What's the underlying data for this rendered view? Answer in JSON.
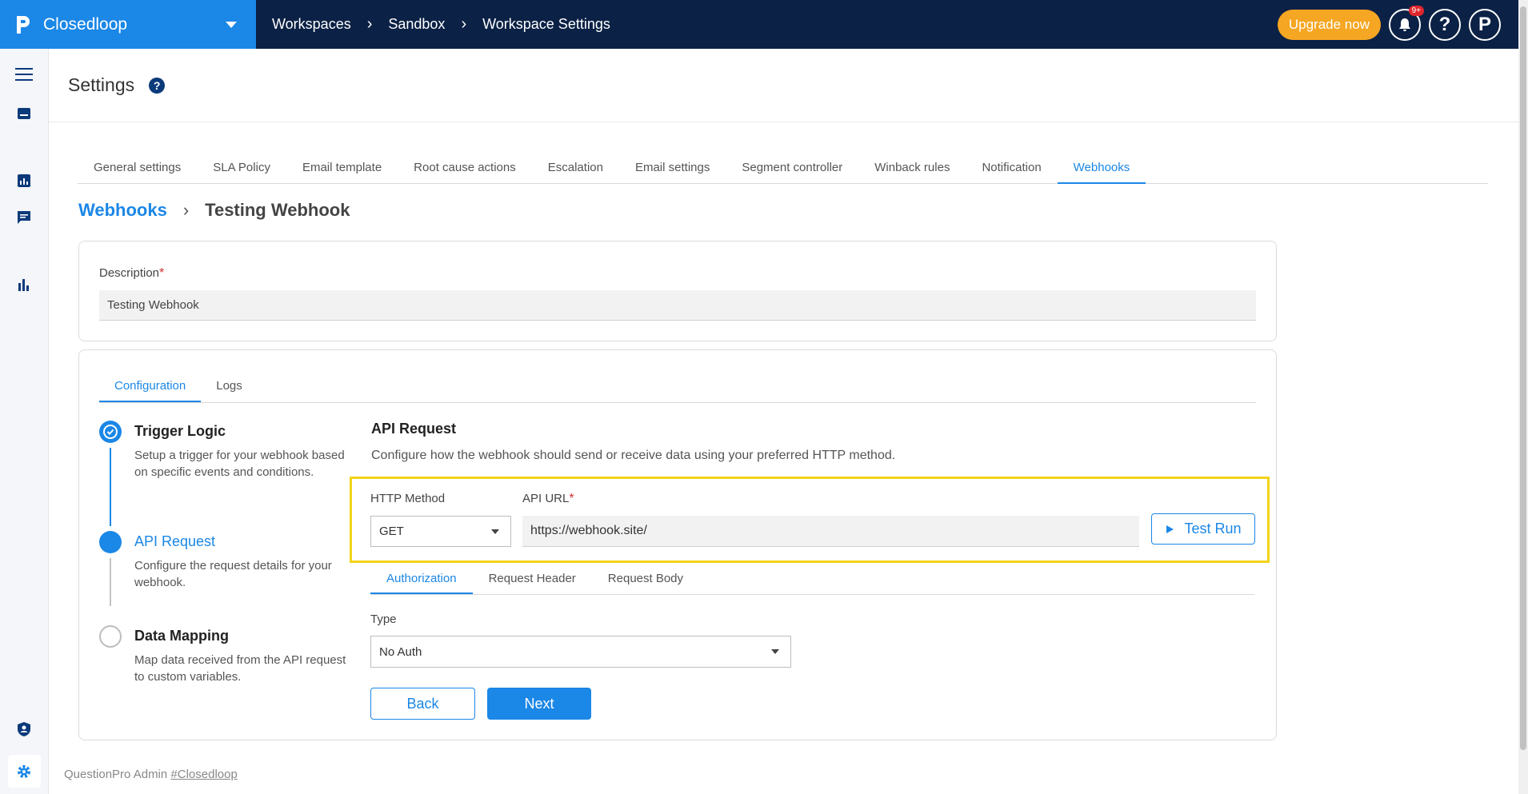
{
  "app": {
    "name": "Closedloop",
    "breadcrumbs": [
      "Workspaces",
      "Sandbox",
      "Workspace Settings"
    ],
    "upgrade_label": "Upgrade now",
    "notification_badge": "9+",
    "help_glyph": "?",
    "profile_glyph": "P"
  },
  "sidebar": {
    "icons": [
      "menu-icon",
      "inbox-icon",
      "dashboard-icon",
      "chat-icon",
      "bar-chart-icon",
      "shield-user-icon",
      "gear-icon"
    ]
  },
  "header": {
    "title": "Settings",
    "help_glyph": "?"
  },
  "tabs": [
    "General settings",
    "SLA Policy",
    "Email template",
    "Root cause actions",
    "Escalation",
    "Email settings",
    "Segment controller",
    "Winback rules",
    "Notification",
    "Webhooks"
  ],
  "active_tab": "Webhooks",
  "breadcrumb": {
    "parent": "Webhooks",
    "current": "Testing Webhook"
  },
  "description": {
    "label": "Description",
    "required_mark": "*",
    "value": "Testing Webhook"
  },
  "config_tabs": [
    "Configuration",
    "Logs"
  ],
  "steps": [
    {
      "title": "Trigger Logic",
      "desc": "Setup a trigger for your webhook based on specific events and conditions.",
      "state": "done"
    },
    {
      "title": "API Request",
      "desc": "Configure the request details for your webhook.",
      "state": "active"
    },
    {
      "title": "Data Mapping",
      "desc": "Map data received from the API request to custom variables.",
      "state": "pending"
    }
  ],
  "api_request": {
    "title": "API Request",
    "subtitle": "Configure how the webhook should send or receive data using your preferred HTTP method.",
    "http_method_label": "HTTP Method",
    "http_method_value": "GET",
    "api_url_label": "API URL",
    "api_url_value": "https://webhook.site/",
    "test_run_label": "Test Run",
    "tabs": [
      "Authorization",
      "Request Header",
      "Request Body"
    ],
    "type_label": "Type",
    "type_value": "No Auth",
    "back_label": "Back",
    "next_label": "Next"
  },
  "footer": {
    "prefix": "QuestionPro Admin",
    "link": "#Closedloop"
  },
  "colors": {
    "primary": "#1b87e6",
    "navbar": "#0b2145",
    "upgrade": "#f5a623",
    "highlight": "#f2d31a",
    "required": "#d32f2f"
  }
}
